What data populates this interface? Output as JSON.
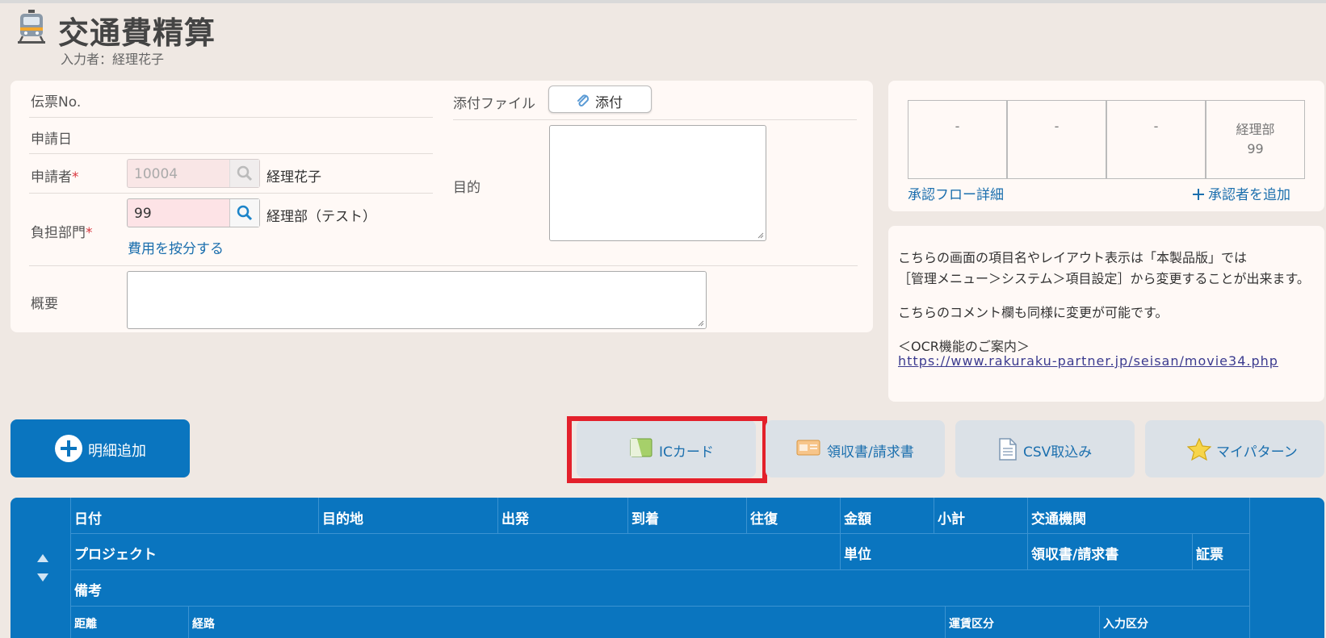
{
  "header": {
    "title": "交通費精算",
    "entered_by": "入力者：経理花子"
  },
  "form": {
    "slip_no_label": "伝票No.",
    "apply_date_label": "申請日",
    "applicant_label": "申請者",
    "applicant_code": "10004",
    "applicant_name": "経理花子",
    "department_label": "負担部門",
    "department_code": "99",
    "department_name": "経理部（テスト）",
    "allocate_link": "費用を按分する",
    "summary_label": "概要",
    "attachment_label": "添付ファイル",
    "attach_button": "添付",
    "purpose_label": "目的",
    "required_mark": "*"
  },
  "approval": {
    "approvers": [
      {
        "line1": "-",
        "line2": ""
      },
      {
        "line1": "-",
        "line2": ""
      },
      {
        "line1": "-",
        "line2": ""
      },
      {
        "line1": "経理部",
        "line2": "99"
      }
    ],
    "flow_detail_link": "承認フロー詳細",
    "add_approver_link": "承認者を追加"
  },
  "comment": {
    "line1": "こちらの画面の項目名やレイアウト表示は「本製品版」では",
    "line2": "［管理メニュー＞システム＞項目設定］から変更することが出来ます。",
    "line3": "こちらのコメント欄も同様に変更が可能です。",
    "line4": "＜OCR機能のご案内＞",
    "url": "https://www.rakuraku-partner.jp/seisan/movie34.php"
  },
  "actions": {
    "add_detail": "明細追加",
    "ic_card": "ICカード",
    "receipt": "領収書/請求書",
    "csv_import": "CSV取込み",
    "my_pattern": "マイパターン"
  },
  "table": {
    "row1": [
      "日付",
      "目的地",
      "出発",
      "到着",
      "往復",
      "金額",
      "小計",
      "交通機関"
    ],
    "row2": [
      "プロジェクト",
      "単位",
      "領収書/請求書",
      "証票"
    ],
    "row3": [
      "備考"
    ],
    "row4": [
      "距離",
      "経路",
      "運賃区分",
      "入力区分"
    ]
  },
  "colors": {
    "primary": "#0a75bf",
    "background": "#efe8e3",
    "highlight": "#e3202b",
    "required": "#d9363e",
    "link": "#1b6fae"
  }
}
